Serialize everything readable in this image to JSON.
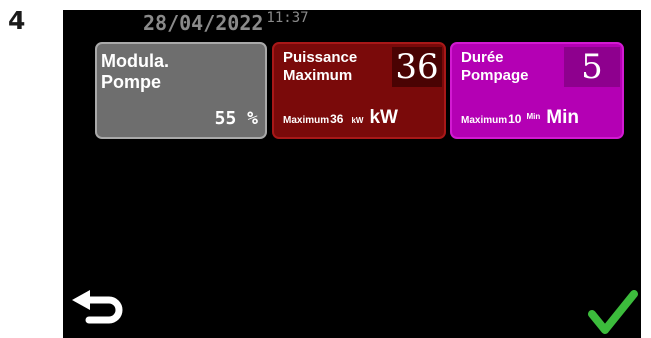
{
  "step_number": "4",
  "header": {
    "date": "28/04/2022",
    "time": "11:37"
  },
  "tiles": {
    "modula": {
      "title_line1": "Modula.",
      "title_line2": "Pompe",
      "value": "55 %"
    },
    "puissance": {
      "title_line1": "Puissance",
      "title_line2": "Maximum",
      "value": "36",
      "max_label": "Maximum",
      "max_value": "36",
      "max_unit_small": "kW",
      "unit": "kW"
    },
    "duree": {
      "title_line1": "Durée",
      "title_line2": "Pompage",
      "value": "5",
      "max_label": "Maximum",
      "max_value": "10",
      "max_unit_small": "Min",
      "unit": "Min"
    }
  },
  "icons": {
    "back": "back-arrow-icon",
    "confirm": "checkmark-icon"
  },
  "colors": {
    "screen_background": "#000000",
    "modula_tile": "#6e6e6e",
    "puissance_tile": "#7a0a0a",
    "duree_tile": "#b400b4",
    "confirm_green": "#3cbc3c",
    "header_text": "#8a8a8a"
  }
}
